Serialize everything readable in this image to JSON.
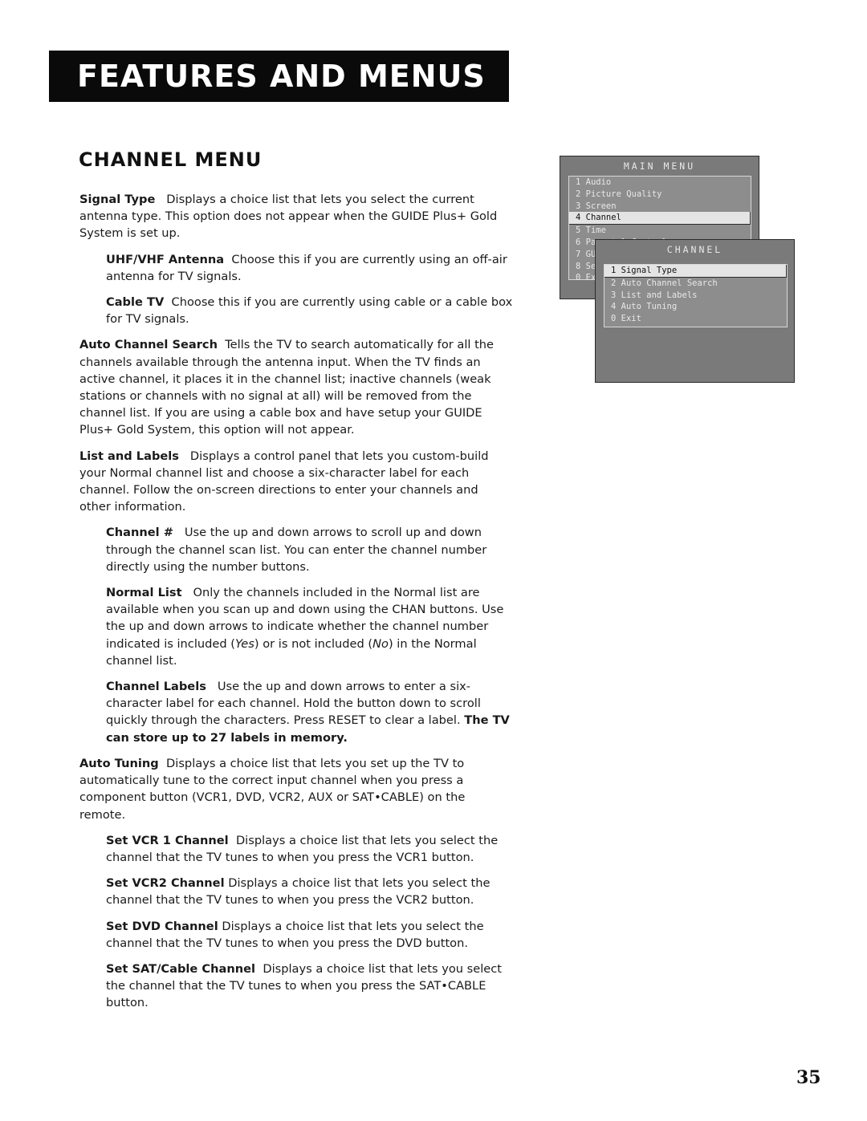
{
  "header": {
    "section_banner": "Features and Menus",
    "page_title": "Channel Menu"
  },
  "paragraphs": [
    {
      "term": "Signal Type",
      "text": "Displays a choice list that lets you select the current antenna type. This option does not appear when the GUIDE Plus+ Gold System is set up.",
      "indent": false
    },
    {
      "term": "UHF/VHF Antenna",
      "text": "Choose this if you are currently using an off-air antenna for TV signals.",
      "indent": true
    },
    {
      "term": "Cable TV",
      "text": "Choose this if you are currently using cable or a cable box for TV signals.",
      "indent": true
    },
    {
      "term": "Auto Channel Search",
      "text": "Tells the TV to search automatically for all the channels available through the antenna input. When the TV finds an active channel, it places it in the channel list; inactive channels (weak stations or channels with no signal at all) will be removed from the channel list. If you are using a cable box and have setup your GUIDE Plus+ Gold System, this option will not appear.",
      "indent": false
    },
    {
      "term": "List and Labels",
      "text": "Displays a control panel that lets you custom-build your Normal channel list and choose a six-character label for each channel. Follow the on-screen directions to enter your channels and other information.",
      "indent": false
    },
    {
      "term": "Channel #",
      "text": "Use the up and down arrows to scroll up and down through the channel scan list. You can enter the channel number directly using the number buttons.",
      "indent": true
    },
    {
      "term": "Normal List",
      "text_before_yes": "Only the channels included in the Normal list are available when you scan up and down using the CHAN buttons. Use the up and down arrows to indicate whether the channel number indicated is included (",
      "yes": "Yes",
      "text_between": ") or is not included (",
      "no": "No",
      "text_after": ") in the Normal channel list.",
      "indent": true
    },
    {
      "term": "Channel Labels",
      "text": "Use the up and down arrows to enter a six-character label for each channel. Hold the button down to scroll quickly through the characters. Press RESET to clear a label.",
      "bold_note": "The TV can store up to 27 labels in memory.",
      "indent": true
    },
    {
      "term": "Auto Tuning",
      "text": "Displays a choice list that lets you set up the TV to automatically tune to the correct input channel when you press a component button (VCR1, DVD, VCR2, AUX or SAT•CABLE) on the remote.",
      "indent": false
    },
    {
      "term": "Set VCR 1 Channel",
      "text": "Displays a choice list that lets you select the channel that the TV tunes to when you press the VCR1 button.",
      "indent": true
    },
    {
      "term": "Set VCR2 Channel",
      "text": "Displays a choice list that lets you select the channel that the TV tunes to when you press the VCR2 button.",
      "indent": true
    },
    {
      "term": "Set DVD Channel",
      "text": "Displays a choice list that lets you select the channel that the TV tunes to when you press the DVD button.",
      "indent": true
    },
    {
      "term": "Set SAT/Cable Channel",
      "text": "Displays a choice list that lets you select the channel that the TV tunes to when you press the SAT•CABLE button.",
      "indent": true
    }
  ],
  "main_menu": {
    "title": "MAIN MENU",
    "items": [
      "1 Audio",
      "2 Picture Quality",
      "3 Screen",
      "4 Channel",
      "5 Time",
      "6 Parental Controls",
      "7 GUIDE Plus+ Menu",
      "8 Setup",
      "0 Exit"
    ],
    "selected_index": 3
  },
  "channel_menu": {
    "title": "CHANNEL",
    "items": [
      "1 Signal Type",
      "2 Auto Channel Search",
      "3 List and Labels",
      "4 Auto Tuning",
      "0 Exit"
    ],
    "selected_index": 0
  },
  "page_number": "35"
}
